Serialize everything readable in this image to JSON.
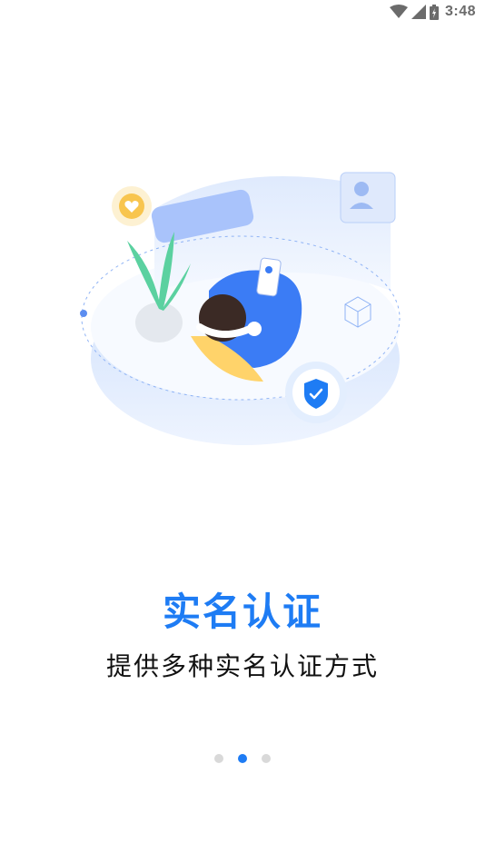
{
  "status_bar": {
    "time": "3:48",
    "icons": [
      "wifi-icon",
      "cellular-signal-icon",
      "battery-icon"
    ]
  },
  "onboarding": {
    "illustration": "identity-verification-illustration",
    "title": "实名认证",
    "subtitle": "提供多种实名认证方式",
    "pages_total": 3,
    "active_page": 2
  },
  "colors": {
    "accent": "#1e7cf4",
    "text_primary": "#111111",
    "dot_inactive": "#d9d9d9"
  }
}
